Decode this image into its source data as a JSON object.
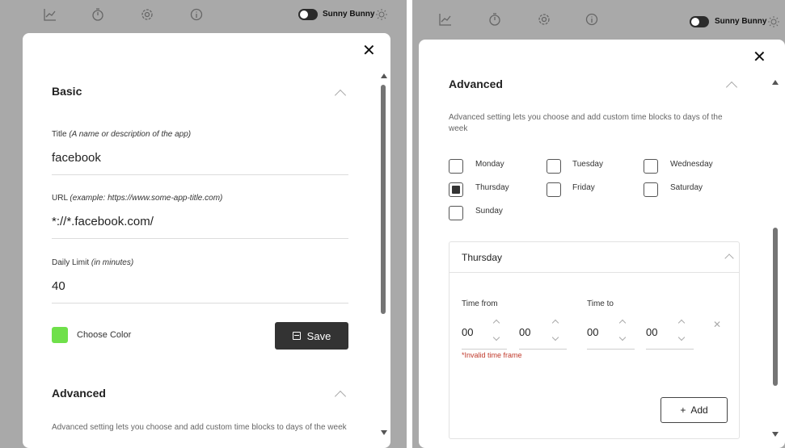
{
  "topbar": {
    "icons": [
      "chart-icon",
      "timer-icon",
      "gear-icon",
      "info-icon"
    ],
    "user_name": "Sunny Bunny",
    "theme_icon": "sun-icon"
  },
  "left": {
    "close_label": "✕",
    "basic": {
      "title": "Basic",
      "title_field": {
        "label": "Title",
        "hint": "(A name or description of the app)",
        "value": "facebook"
      },
      "url_field": {
        "label": "URL",
        "hint": "(example: https://www.some-app-title.com)",
        "value": "*://*.facebook.com/"
      },
      "limit_field": {
        "label": "Daily Limit",
        "hint": "(in minutes)",
        "value": "40"
      },
      "color_label": "Choose Color",
      "color": "#6fe04a",
      "save_label": "Save"
    },
    "advanced": {
      "title": "Advanced",
      "description": "Advanced setting lets you choose and add custom time blocks to days of the week"
    }
  },
  "right": {
    "close_label": "✕",
    "advanced": {
      "title": "Advanced",
      "description": "Advanced setting lets you choose and add custom time blocks to days of the week",
      "days": [
        {
          "label": "Monday",
          "checked": false
        },
        {
          "label": "Tuesday",
          "checked": false
        },
        {
          "label": "Wednesday",
          "checked": false
        },
        {
          "label": "Thursday",
          "checked": true
        },
        {
          "label": "Friday",
          "checked": false
        },
        {
          "label": "Saturday",
          "checked": false
        },
        {
          "label": "Sunday",
          "checked": false
        }
      ],
      "day_card": {
        "title": "Thursday",
        "time_from_label": "Time from",
        "time_to_label": "Time to",
        "from_hours": "00",
        "from_minutes": "00",
        "to_hours": "00",
        "to_minutes": "00",
        "error": "*Invalid time frame",
        "remove_label": "✕",
        "add_label": "Add",
        "add_icon": "+"
      }
    }
  }
}
